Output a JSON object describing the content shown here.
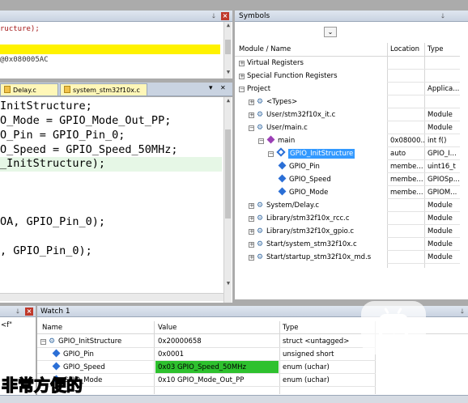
{
  "top_editor": {
    "lines": [
      "ructure);",
      "",
      "@0x080005AC",
      ""
    ]
  },
  "tabs": [
    {
      "label": "Delay.c"
    },
    {
      "label": "system_stm32f10x.c"
    }
  ],
  "tab_menu_glyph": "▾",
  "tab_close_glyph": "✕",
  "main_editor": {
    "lines": [
      "InitStructure;",
      "O_Mode = GPIO_Mode_Out_PP;",
      "O_Pin = GPIO_Pin_0;",
      "O_Speed = GPIO_Speed_50MHz;",
      "_InitStructure);",
      "",
      "",
      "OA, GPIO_Pin_0);",
      "",
      ", GPIO_Pin_0);",
      ""
    ]
  },
  "symbols": {
    "title": "Symbols",
    "columns": [
      "Module / Name",
      "Location",
      "Type"
    ],
    "rows": [
      {
        "indent": 0,
        "expander": "+",
        "icon": "none",
        "name": "Virtual Registers",
        "location": "",
        "type": ""
      },
      {
        "indent": 0,
        "expander": "+",
        "icon": "none",
        "name": "Special Function Registers",
        "location": "",
        "type": ""
      },
      {
        "indent": 0,
        "expander": "−",
        "icon": "none",
        "name": "Project",
        "location": "",
        "type": "Applica..."
      },
      {
        "indent": 1,
        "expander": "+",
        "icon": "gear",
        "name": "<Types>",
        "location": "",
        "type": ""
      },
      {
        "indent": 1,
        "expander": "+",
        "icon": "gear",
        "name": "User/stm32f10x_it.c",
        "location": "",
        "type": "Module"
      },
      {
        "indent": 1,
        "expander": "−",
        "icon": "gear",
        "name": "User/main.c",
        "location": "",
        "type": "Module"
      },
      {
        "indent": 2,
        "expander": "−",
        "icon": "fn",
        "name": "main",
        "location": "0x08000...",
        "type": "int f()"
      },
      {
        "indent": 3,
        "expander": "−",
        "icon": "struct",
        "name": "GPIO_InitStructure",
        "location": "auto",
        "type": "GPIO_I...",
        "selected": true
      },
      {
        "indent": 4,
        "expander": "",
        "icon": "dia",
        "name": "GPIO_Pin",
        "location": "membe...",
        "type": "uint16_t"
      },
      {
        "indent": 4,
        "expander": "",
        "icon": "dia",
        "name": "GPIO_Speed",
        "location": "membe...",
        "type": "GPIOSp..."
      },
      {
        "indent": 4,
        "expander": "",
        "icon": "dia",
        "name": "GPIO_Mode",
        "location": "membe...",
        "type": "GPIOM..."
      },
      {
        "indent": 1,
        "expander": "+",
        "icon": "gear",
        "name": "System/Delay.c",
        "location": "",
        "type": "Module"
      },
      {
        "indent": 1,
        "expander": "+",
        "icon": "gear",
        "name": "Library/stm32f10x_rcc.c",
        "location": "",
        "type": "Module"
      },
      {
        "indent": 1,
        "expander": "+",
        "icon": "gear",
        "name": "Library/stm32f10x_gpio.c",
        "location": "",
        "type": "Module"
      },
      {
        "indent": 1,
        "expander": "+",
        "icon": "gear",
        "name": "Start/system_stm32f10x.c",
        "location": "",
        "type": "Module"
      },
      {
        "indent": 1,
        "expander": "+",
        "icon": "gear",
        "name": "Start/startup_stm32f10x_md.s",
        "location": "",
        "type": "Module"
      }
    ]
  },
  "left_bottom": {
    "text": "<f\""
  },
  "watch": {
    "title": "Watch 1",
    "columns": [
      "Name",
      "Value",
      "Type"
    ],
    "rows": [
      {
        "indent": 0,
        "expander": "−",
        "icon": "gear",
        "name": "GPIO_InitStructure",
        "value": "0x20000658",
        "type": "struct <untagged>"
      },
      {
        "indent": 1,
        "expander": "",
        "icon": "dia",
        "name": "GPIO_Pin",
        "value": "0x0001",
        "type": "unsigned short"
      },
      {
        "indent": 1,
        "expander": "",
        "icon": "dia",
        "name": "GPIO_Speed",
        "value": "0x03 GPIO_Speed_50MHz",
        "type": "enum (uchar)",
        "value_highlight": true
      },
      {
        "indent": 1,
        "expander": "",
        "icon": "dia",
        "name": "GPIO_Mode",
        "value": "0x10 GPIO_Mode_Out_PP",
        "type": "enum (uchar)"
      }
    ]
  },
  "subtitle_overlay": "非常方便的",
  "colors": {
    "selection": "#3399ff",
    "value_highlight": "#2ec12e",
    "code_yellow": "#fff200"
  }
}
